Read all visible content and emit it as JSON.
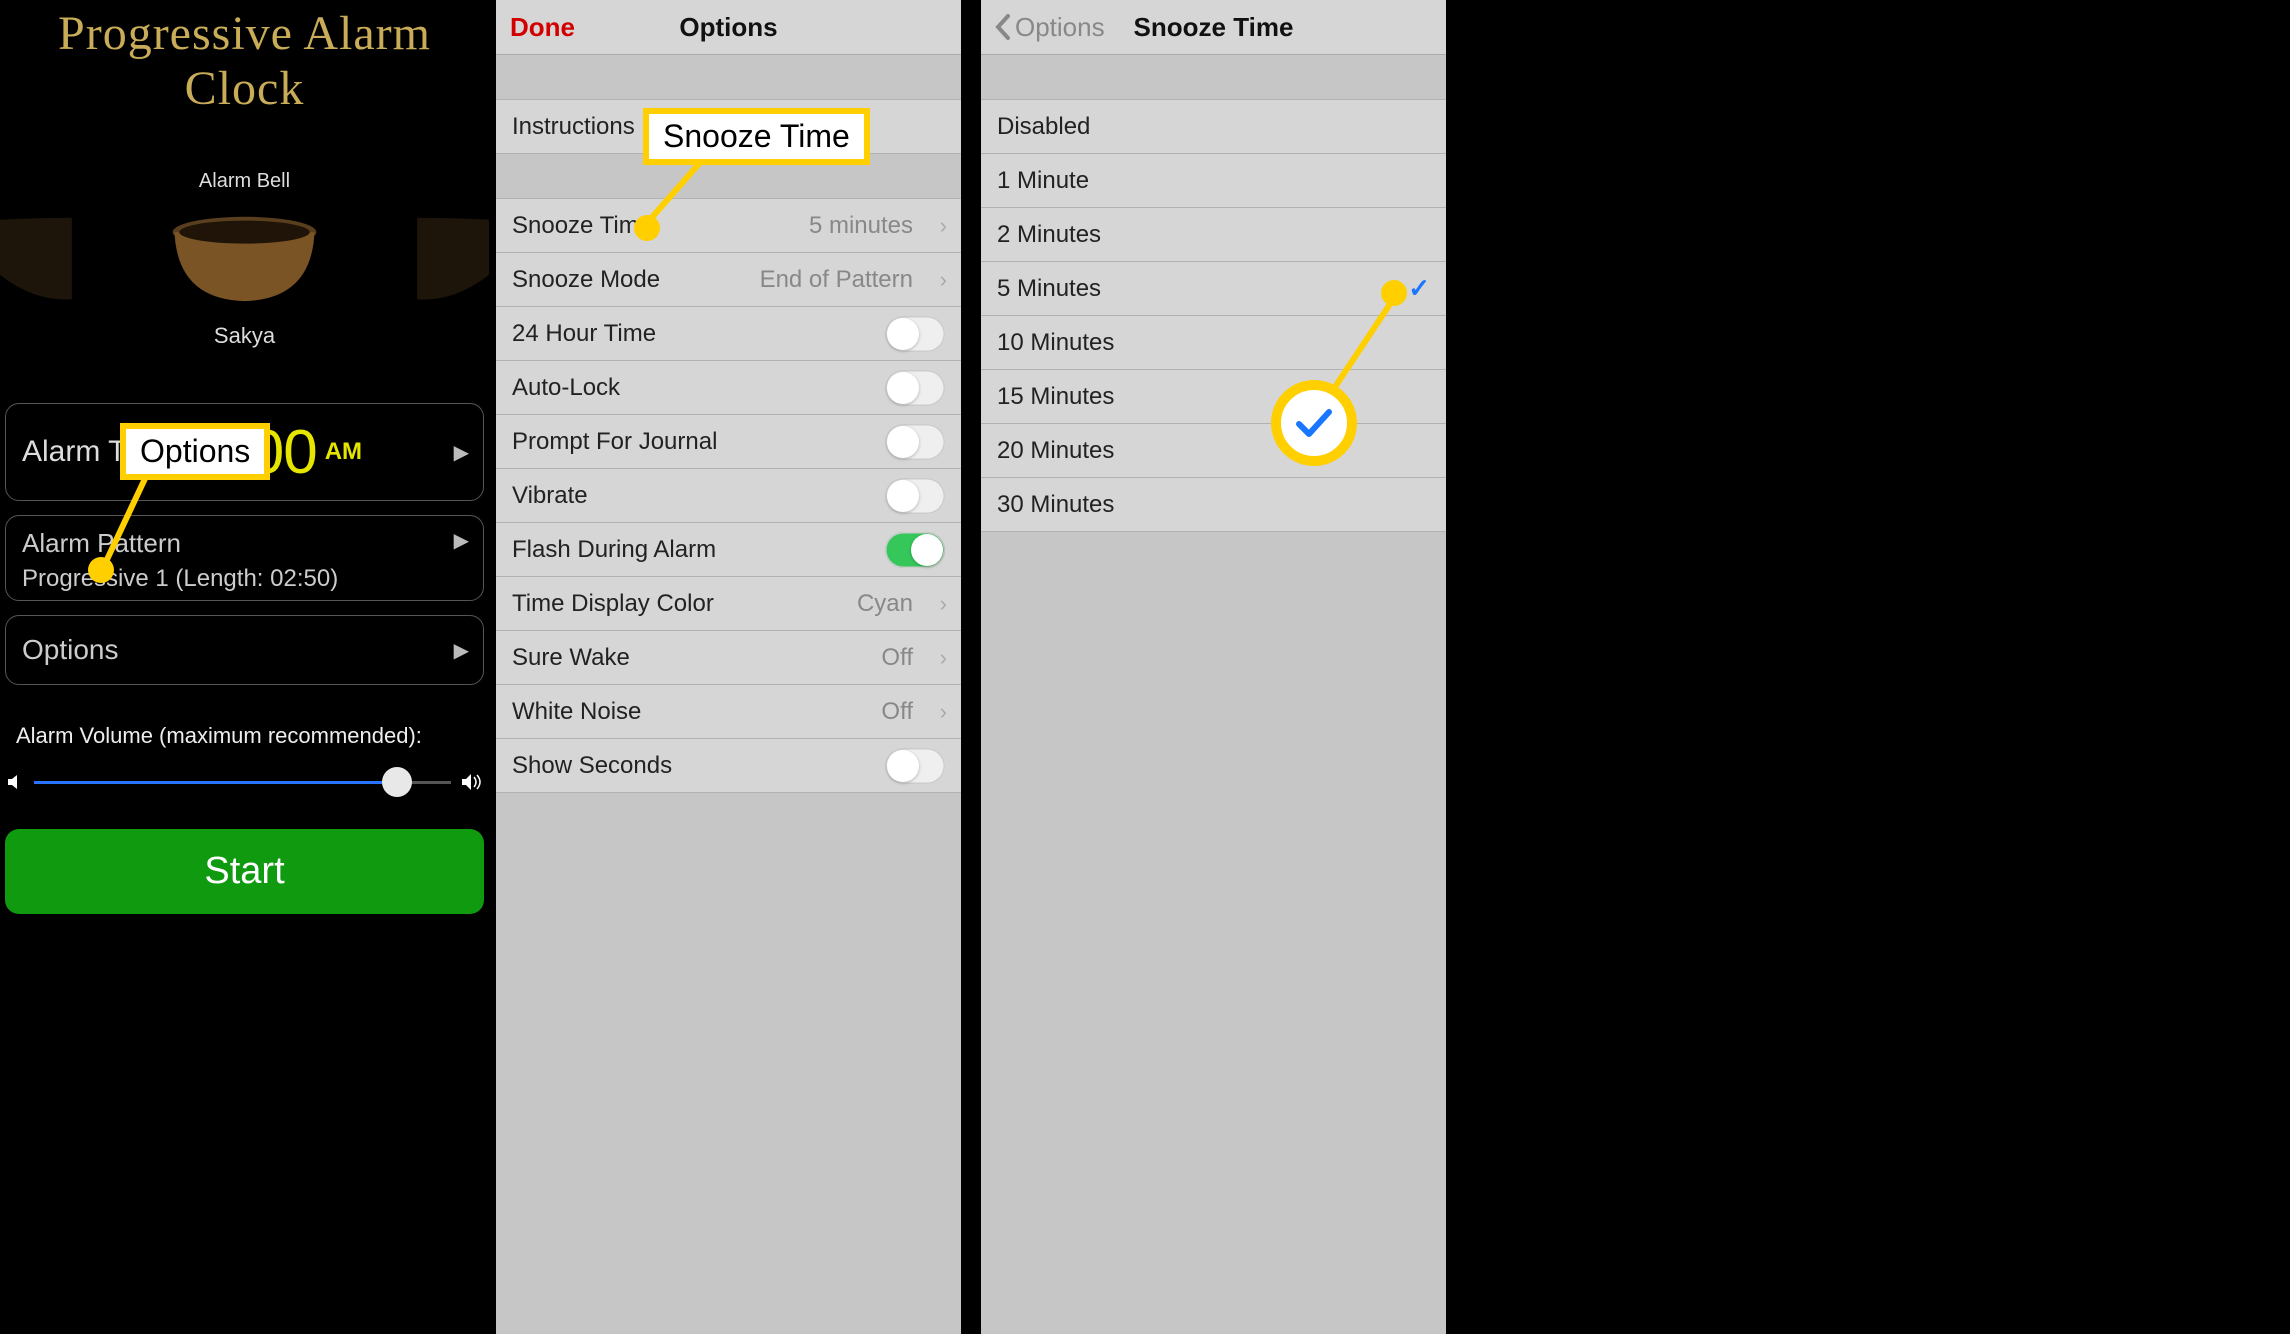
{
  "panel1": {
    "title": "Progressive Alarm Clock",
    "bell_label": "Alarm Bell",
    "bell_name": "Sakya",
    "alarm_time_label": "Alarm Time:",
    "alarm_time_value": "8:00",
    "alarm_time_ampm": "AM",
    "pattern_label": "Alarm Pattern",
    "pattern_value": "Progressive 1 (Length: 02:50)",
    "options_label": "Options",
    "volume_label": "Alarm Volume (maximum recommended):",
    "slider_pct": 87,
    "start_label": "Start"
  },
  "panel2": {
    "done": "Done",
    "title": "Options",
    "group_a": [
      {
        "label": "Instructions"
      }
    ],
    "group_b": [
      {
        "label": "Snooze Time",
        "value": "5 minutes",
        "disclosure": true
      },
      {
        "label": "Snooze Mode",
        "value": "End of Pattern",
        "disclosure": true
      },
      {
        "label": "24 Hour Time",
        "toggle": false
      },
      {
        "label": "Auto-Lock",
        "toggle": false
      },
      {
        "label": "Prompt For Journal",
        "toggle": false
      },
      {
        "label": "Vibrate",
        "toggle": false
      },
      {
        "label": "Flash During Alarm",
        "toggle": true
      },
      {
        "label": "Time Display Color",
        "value": "Cyan",
        "disclosure": true
      },
      {
        "label": "Sure Wake",
        "value": "Off",
        "disclosure": true
      },
      {
        "label": "White Noise",
        "value": "Off",
        "disclosure": true
      },
      {
        "label": "Show Seconds",
        "toggle": false
      }
    ]
  },
  "panel3": {
    "back": "Options",
    "title": "Snooze Time",
    "items": [
      {
        "label": "Disabled",
        "checked": false
      },
      {
        "label": "1 Minute",
        "checked": false
      },
      {
        "label": "2 Minutes",
        "checked": false
      },
      {
        "label": "5 Minutes",
        "checked": true
      },
      {
        "label": "10 Minutes",
        "checked": false
      },
      {
        "label": "15 Minutes",
        "checked": false
      },
      {
        "label": "20 Minutes",
        "checked": false
      },
      {
        "label": "30 Minutes",
        "checked": false
      }
    ]
  },
  "callouts": {
    "options_box_text": "Options",
    "snooze_box_text": "Snooze Time"
  }
}
